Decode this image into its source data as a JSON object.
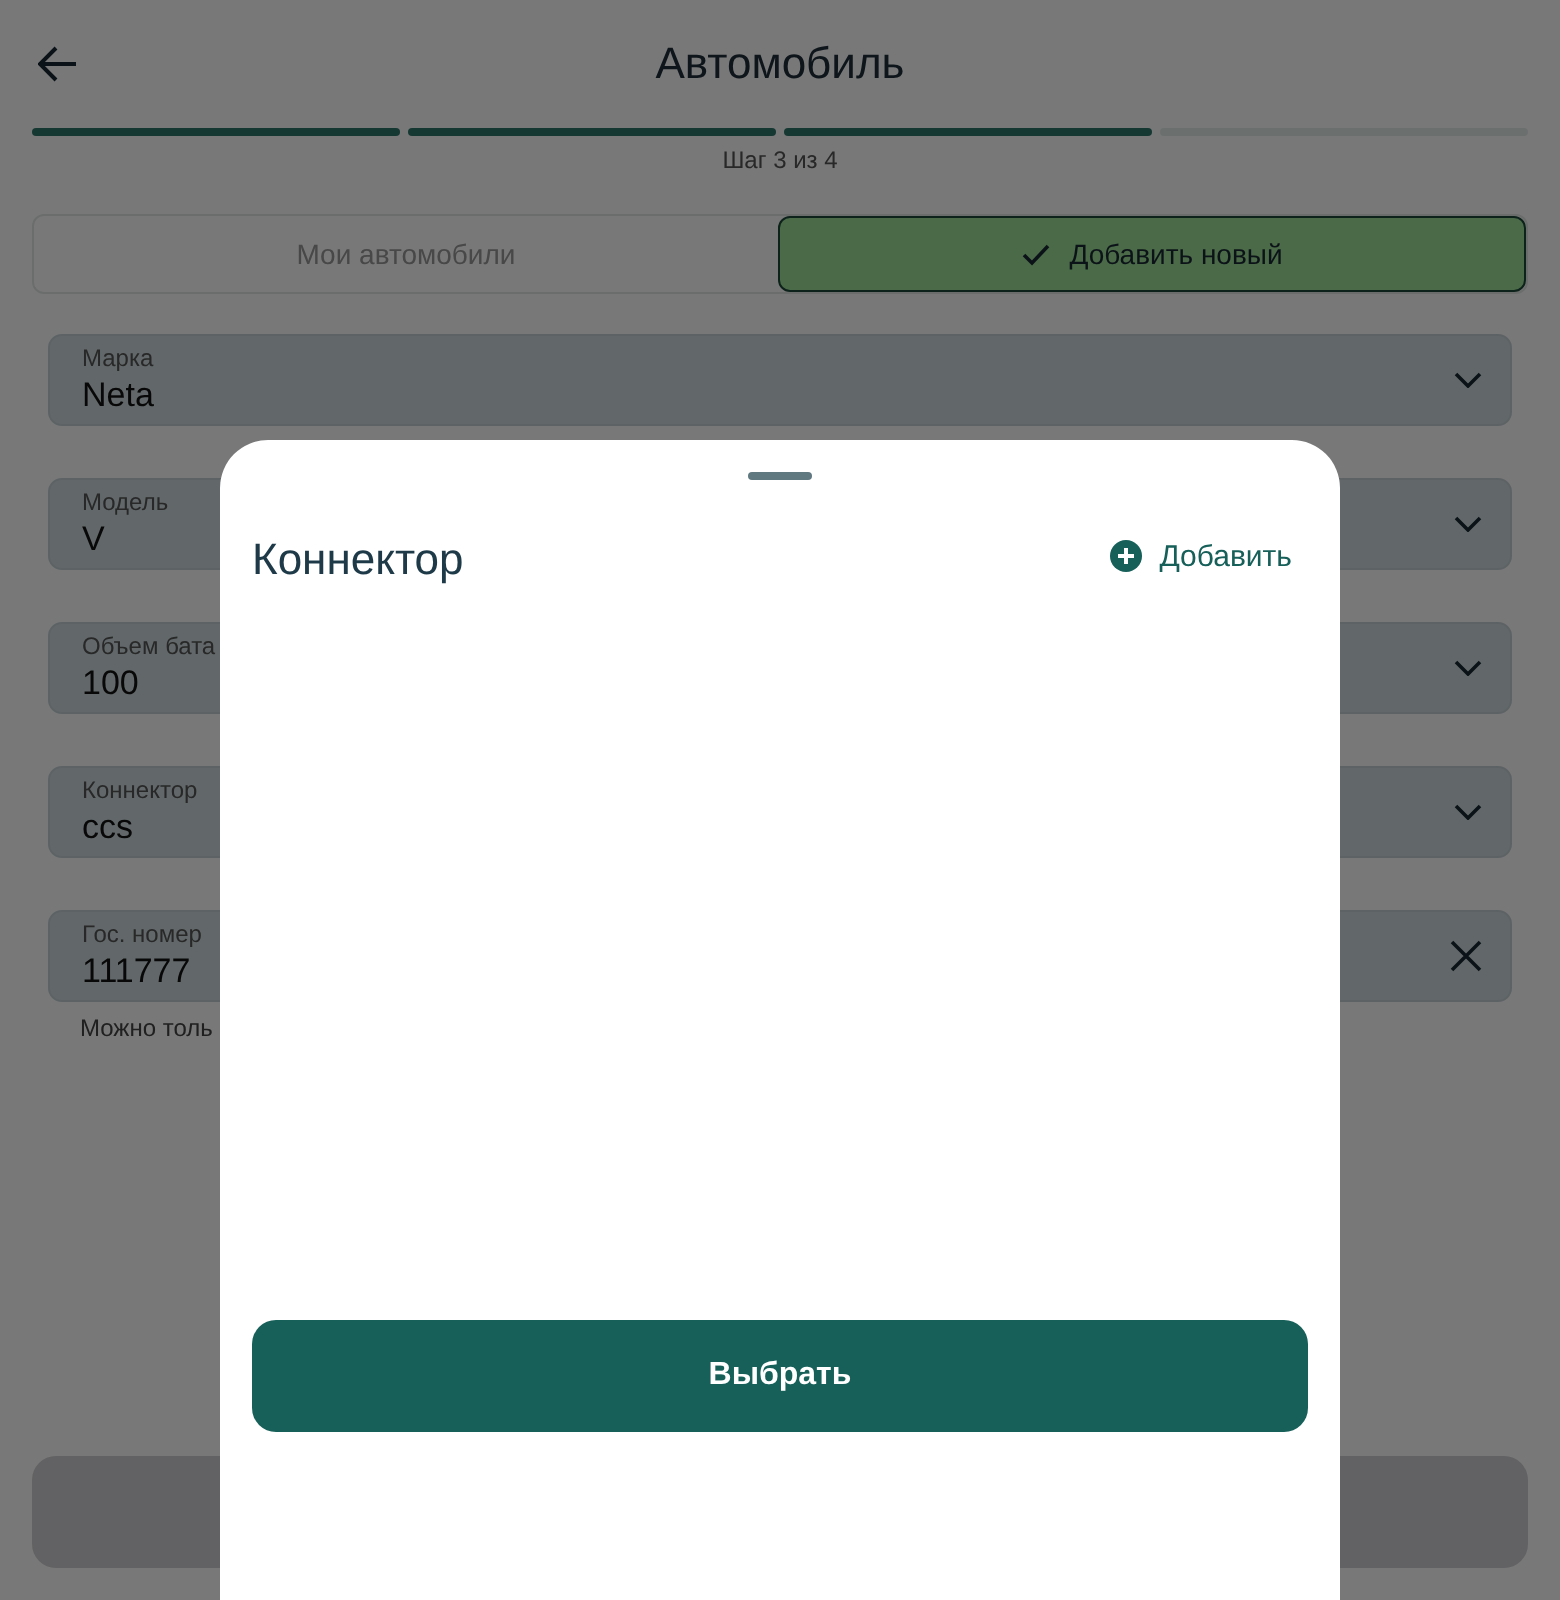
{
  "header": {
    "title": "Автомобиль"
  },
  "progress": {
    "steps": [
      {
        "done": true
      },
      {
        "done": true
      },
      {
        "done": true
      },
      {
        "done": false
      }
    ],
    "caption": "Шаг 3 из 4"
  },
  "tabs": [
    {
      "label": "Мои автомобили",
      "selected": false
    },
    {
      "label": "Добавить новый",
      "selected": true
    }
  ],
  "fields": [
    {
      "label": "Марка",
      "value": "Neta",
      "kind": "dropdown"
    },
    {
      "label": "Модель",
      "value": "V",
      "kind": "dropdown"
    },
    {
      "label": "Объем бата",
      "value": "100",
      "kind": "dropdown"
    },
    {
      "label": "Коннектор",
      "value": "ccs",
      "kind": "dropdown"
    },
    {
      "label": "Гос. номер",
      "value": "111777",
      "kind": "clearable"
    }
  ],
  "field_hint": "Можно толь",
  "sheet": {
    "title": "Коннектор",
    "add_label": "Добавить",
    "select_label": "Выбрать"
  }
}
